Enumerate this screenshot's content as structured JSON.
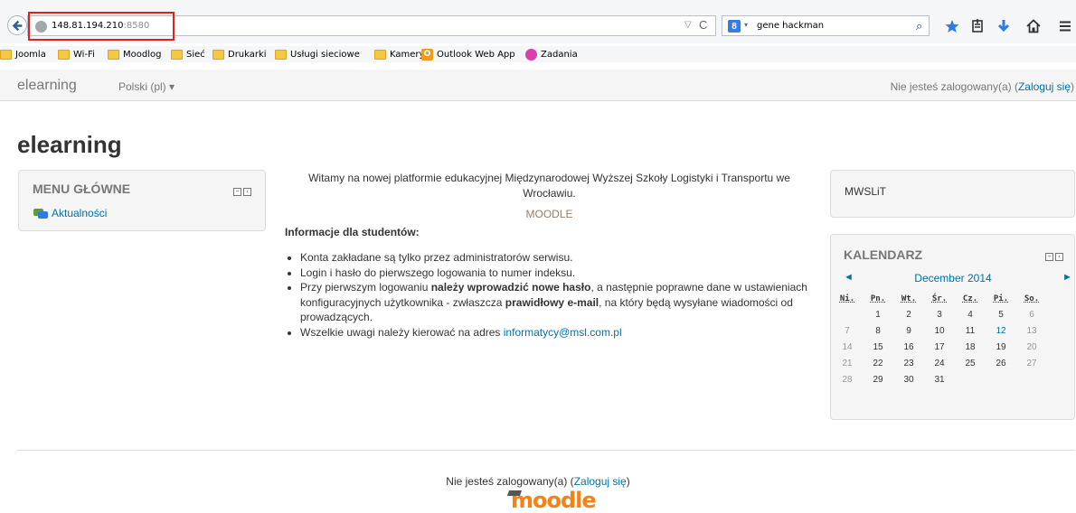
{
  "browser": {
    "url_host": "148.81.194.210",
    "url_port": ":8580",
    "search_query": "gene hackman",
    "search_engine_glyph": "8",
    "bookmarks": [
      {
        "label": "Joomla",
        "icon": "folder-icon"
      },
      {
        "label": "Wi-Fi",
        "icon": "folder-icon"
      },
      {
        "label": "Moodlog",
        "icon": "folder-icon"
      },
      {
        "label": "Sieć",
        "icon": "folder-icon"
      },
      {
        "label": "Drukarki",
        "icon": "folder-icon"
      },
      {
        "label": "Usługi sieciowe",
        "icon": "folder-icon"
      },
      {
        "label": "Kamery",
        "icon": "folder-icon"
      },
      {
        "label": "Outlook Web App",
        "icon": "outlook-icon"
      },
      {
        "label": "Zadania",
        "icon": "zadania-icon"
      }
    ],
    "outlook_glyph": "O"
  },
  "navbar": {
    "brand": "elearning",
    "language": "Polski (pl) ▾",
    "login_prefix": "Nie jesteś zalogowany(a) (",
    "login_link": "Zaloguj się",
    "login_suffix": ")"
  },
  "page_title": "elearning",
  "main_menu": {
    "title": "MENU GŁÓWNE",
    "items": [
      {
        "label": "Aktualności",
        "icon": "forum-icon"
      }
    ]
  },
  "main": {
    "welcome": "Witamy na nowej platformie edukacyjnej Międzynarodowej Wyższej Szkoły Logistyki i Transportu we Wrocławiu.",
    "caption": "MOODLE",
    "heading": "Informacje dla studentów:",
    "bullet1": "Konta zakładane są tylko przez administratorów serwisu.",
    "bullet2": "Login i hasło do pierwszego logowania to numer indeksu.",
    "bullet3_a": "Przy pierwszym logowaniu ",
    "bullet3_b": "należy wprowadzić nowe hasło",
    "bullet3_c": ", a następnie poprawne dane w ustawieniach konfiguracyjnych użytkownika - zwłaszcza ",
    "bullet3_d": "prawidłowy e-mail",
    "bullet3_e": ", na który będą wysyłane wiadomości od prowadzących.",
    "bullet4_a": "Wszelkie uwagi należy kierować na adres ",
    "bullet4_email": "informatycy@msl.com.pl"
  },
  "mwslit_block": {
    "title": "MWSLiT"
  },
  "calendar": {
    "title": "KALENDARZ",
    "month": "December 2014",
    "prev": "◄",
    "next": "►",
    "weekdays": [
      "Ni.",
      "Pn.",
      "Wt.",
      "Śr.",
      "Cz.",
      "Pi.",
      "So."
    ],
    "weeks": [
      [
        "",
        "1",
        "2",
        "3",
        "4",
        "5",
        "6"
      ],
      [
        "7",
        "8",
        "9",
        "10",
        "11",
        "12",
        "13"
      ],
      [
        "14",
        "15",
        "16",
        "17",
        "18",
        "19",
        "20"
      ],
      [
        "21",
        "22",
        "23",
        "24",
        "25",
        "26",
        "27"
      ],
      [
        "28",
        "29",
        "30",
        "31",
        "",
        "",
        ""
      ]
    ],
    "today": "12"
  },
  "footer": {
    "login_prefix": "Nie jesteś zalogowany(a) (",
    "login_link": "Zaloguj się",
    "login_suffix": ")",
    "logo": "moodle"
  },
  "colors": {
    "link": "#0070a8",
    "url_highlight": "#e0211d",
    "moodle_orange": "#f98012"
  }
}
